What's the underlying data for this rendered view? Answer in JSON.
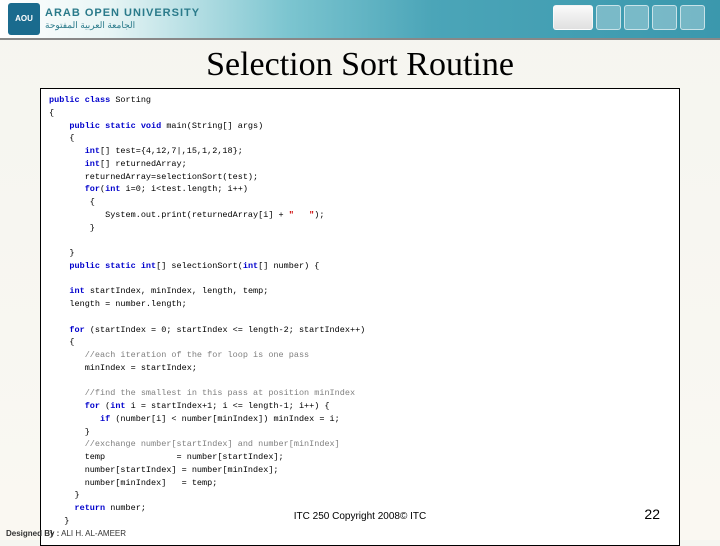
{
  "header": {
    "logo_abbrev": "AOU",
    "uni_name": "ARAB OPEN UNIVERSITY",
    "uni_arabic": "الجامعة العربية المفتوحة"
  },
  "title": "Selection Sort Routine",
  "code": {
    "l01a": "public class",
    "l01b": " Sorting",
    "l02": "{",
    "l03a": "    public static void",
    "l03b": " main(String[] args)",
    "l04": "    {",
    "l05a": "       int",
    "l05b": "[] test={4,12,7|,15,1,2,18};",
    "l06a": "       int",
    "l06b": "[] returnedArray;",
    "l07": "       returnedArray=selectionSort(test);",
    "l08a": "       for",
    "l08b": "(",
    "l08c": "int",
    "l08d": " i=0; i<test.length; i++)",
    "l09": "        {",
    "l10a": "           System.out.print(returnedArray[i] + ",
    "l10b": "\"   \"",
    "l10c": ");",
    "l11": "        }",
    "l12": "",
    "l13": "    }",
    "l14a": "    public static int",
    "l14b": "[] selectionSort(",
    "l14c": "int",
    "l14d": "[] number) {",
    "l15": "",
    "l16a": "    int",
    "l16b": " startIndex, minIndex, length, temp;",
    "l17": "    length = number.length;",
    "l18": "",
    "l19a": "    for",
    "l19b": " (startIndex = 0; startIndex <= length-2; startIndex++)",
    "l20": "    {",
    "l21": "       //each iteration of the for loop is one pass",
    "l22": "       minIndex = startIndex;",
    "l23": "",
    "l24": "       //find the smallest in this pass at position minIndex",
    "l25a": "       for",
    "l25b": " (",
    "l25c": "int",
    "l25d": " i = startIndex+1; i <= length-1; i++) {",
    "l26a": "          if",
    "l26b": " (number[i] < number[minIndex]) minIndex = i;",
    "l27": "       }",
    "l28": "       //exchange number[startIndex] and number[minIndex]",
    "l29": "       temp              = number[startIndex];",
    "l30": "       number[startIndex] = number[minIndex];",
    "l31": "       number[minIndex]   = temp;",
    "l32": "     }",
    "l33a": "     return",
    "l33b": " number;",
    "l34": "   }",
    "l35": "}"
  },
  "footer": "ITC 250 Copyright 2008© ITC",
  "page": "22",
  "designer_label": "Designed By :",
  "designer_name": "ALI H. AL-AMEER"
}
